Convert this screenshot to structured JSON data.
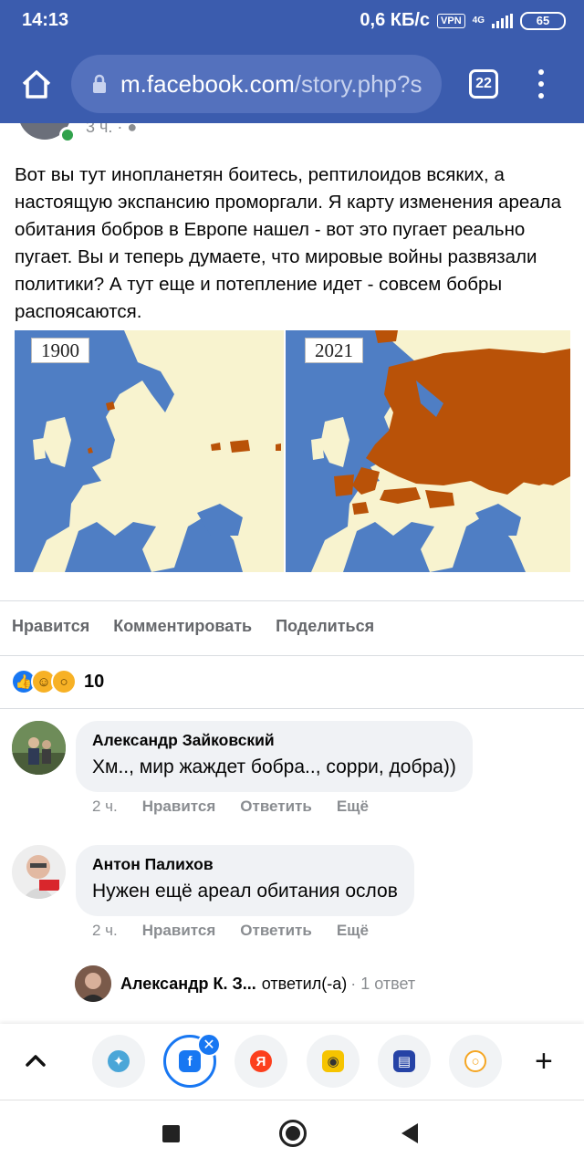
{
  "status_bar": {
    "time": "14:13",
    "speed": "0,6 КБ/с",
    "vpn": "VPN",
    "network": "4G",
    "battery": "65"
  },
  "browser": {
    "url_domain": "m.facebook.com",
    "url_path": "/story.php?s",
    "tab_count": "22"
  },
  "post": {
    "time_partial": "3 ч. ·",
    "text": "Вот вы тут инопланетян боитесь, рептилоидов всяких, а настоящую экспансию проморгали. Я карту изменения ареала обитания бобров в Европе нашел - вот это пугает реально пугает. Вы и теперь думаете, что мировые войны развязали политики? А тут еще и потепление идет - совсем бобры распоясаются.",
    "image": {
      "year_left": "1900",
      "year_right": "2021",
      "colors": {
        "sea": "#4f7ec4",
        "land": "#f8f3cf",
        "range": "#b95208"
      }
    }
  },
  "actions": {
    "like": "Нравится",
    "comment": "Комментировать",
    "share": "Поделиться"
  },
  "reactions": {
    "icons": [
      "like-icon",
      "haha-icon",
      "wow-icon"
    ],
    "count": "10"
  },
  "comments": [
    {
      "author": "Александр Зайковский",
      "text": "Хм.., мир жаждет бобра.., сорри, добра))",
      "time": "2 ч.",
      "like": "Нравится",
      "reply": "Ответить",
      "more": "Ещё"
    },
    {
      "author": "Антон Палихов",
      "text": "Нужен ещё ареал обитания ослов",
      "time": "2 ч.",
      "like": "Нравится",
      "reply": "Ответить",
      "more": "Ещё"
    }
  ],
  "reply_summary": {
    "author": "Александр К. З...",
    "action": "ответил(-а)",
    "count": "· 1 ответ"
  },
  "app_bar": {
    "apps": [
      "alice-icon",
      "facebook-icon",
      "yandex-icon",
      "browser-icon",
      "book-icon",
      "chat-icon"
    ]
  }
}
